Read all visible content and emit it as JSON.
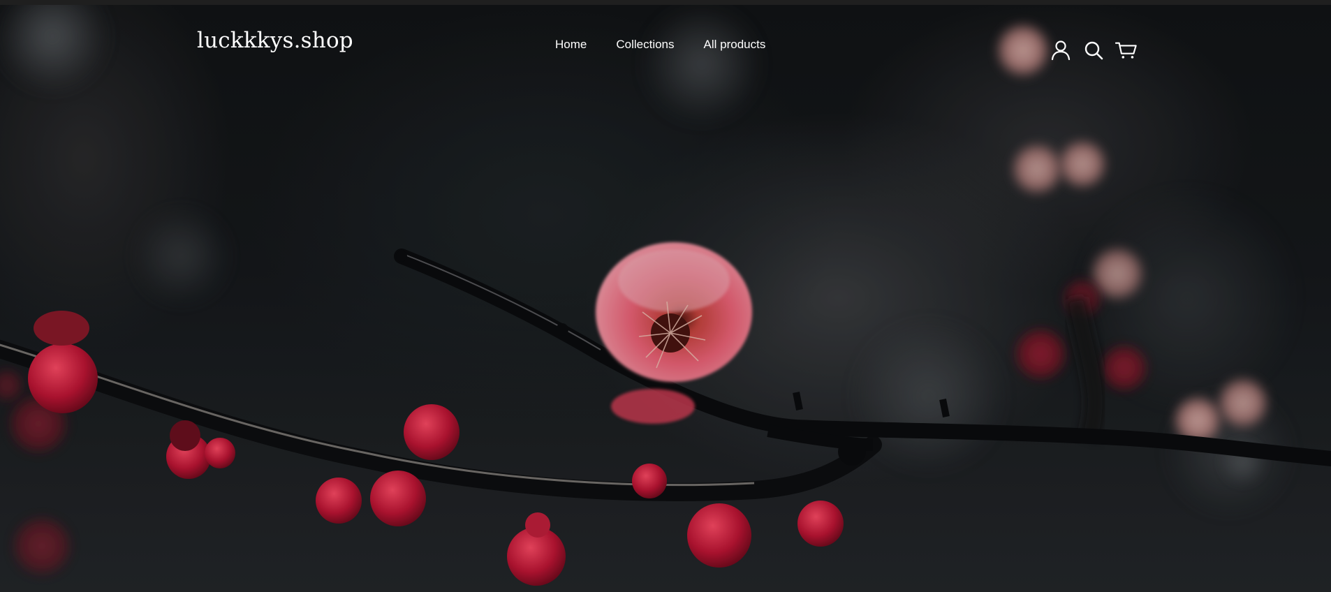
{
  "store": {
    "name": "luckkkys.shop"
  },
  "nav": {
    "items": [
      {
        "label": "Home"
      },
      {
        "label": "Collections"
      },
      {
        "label": "All products"
      }
    ]
  },
  "header_icons": [
    {
      "name": "account-icon"
    },
    {
      "name": "search-icon"
    },
    {
      "name": "cart-icon"
    }
  ],
  "colors": {
    "header_text": "#ffffff",
    "blossom": "#e2344f",
    "branch": "#15171a",
    "background": "#1c1f22"
  }
}
